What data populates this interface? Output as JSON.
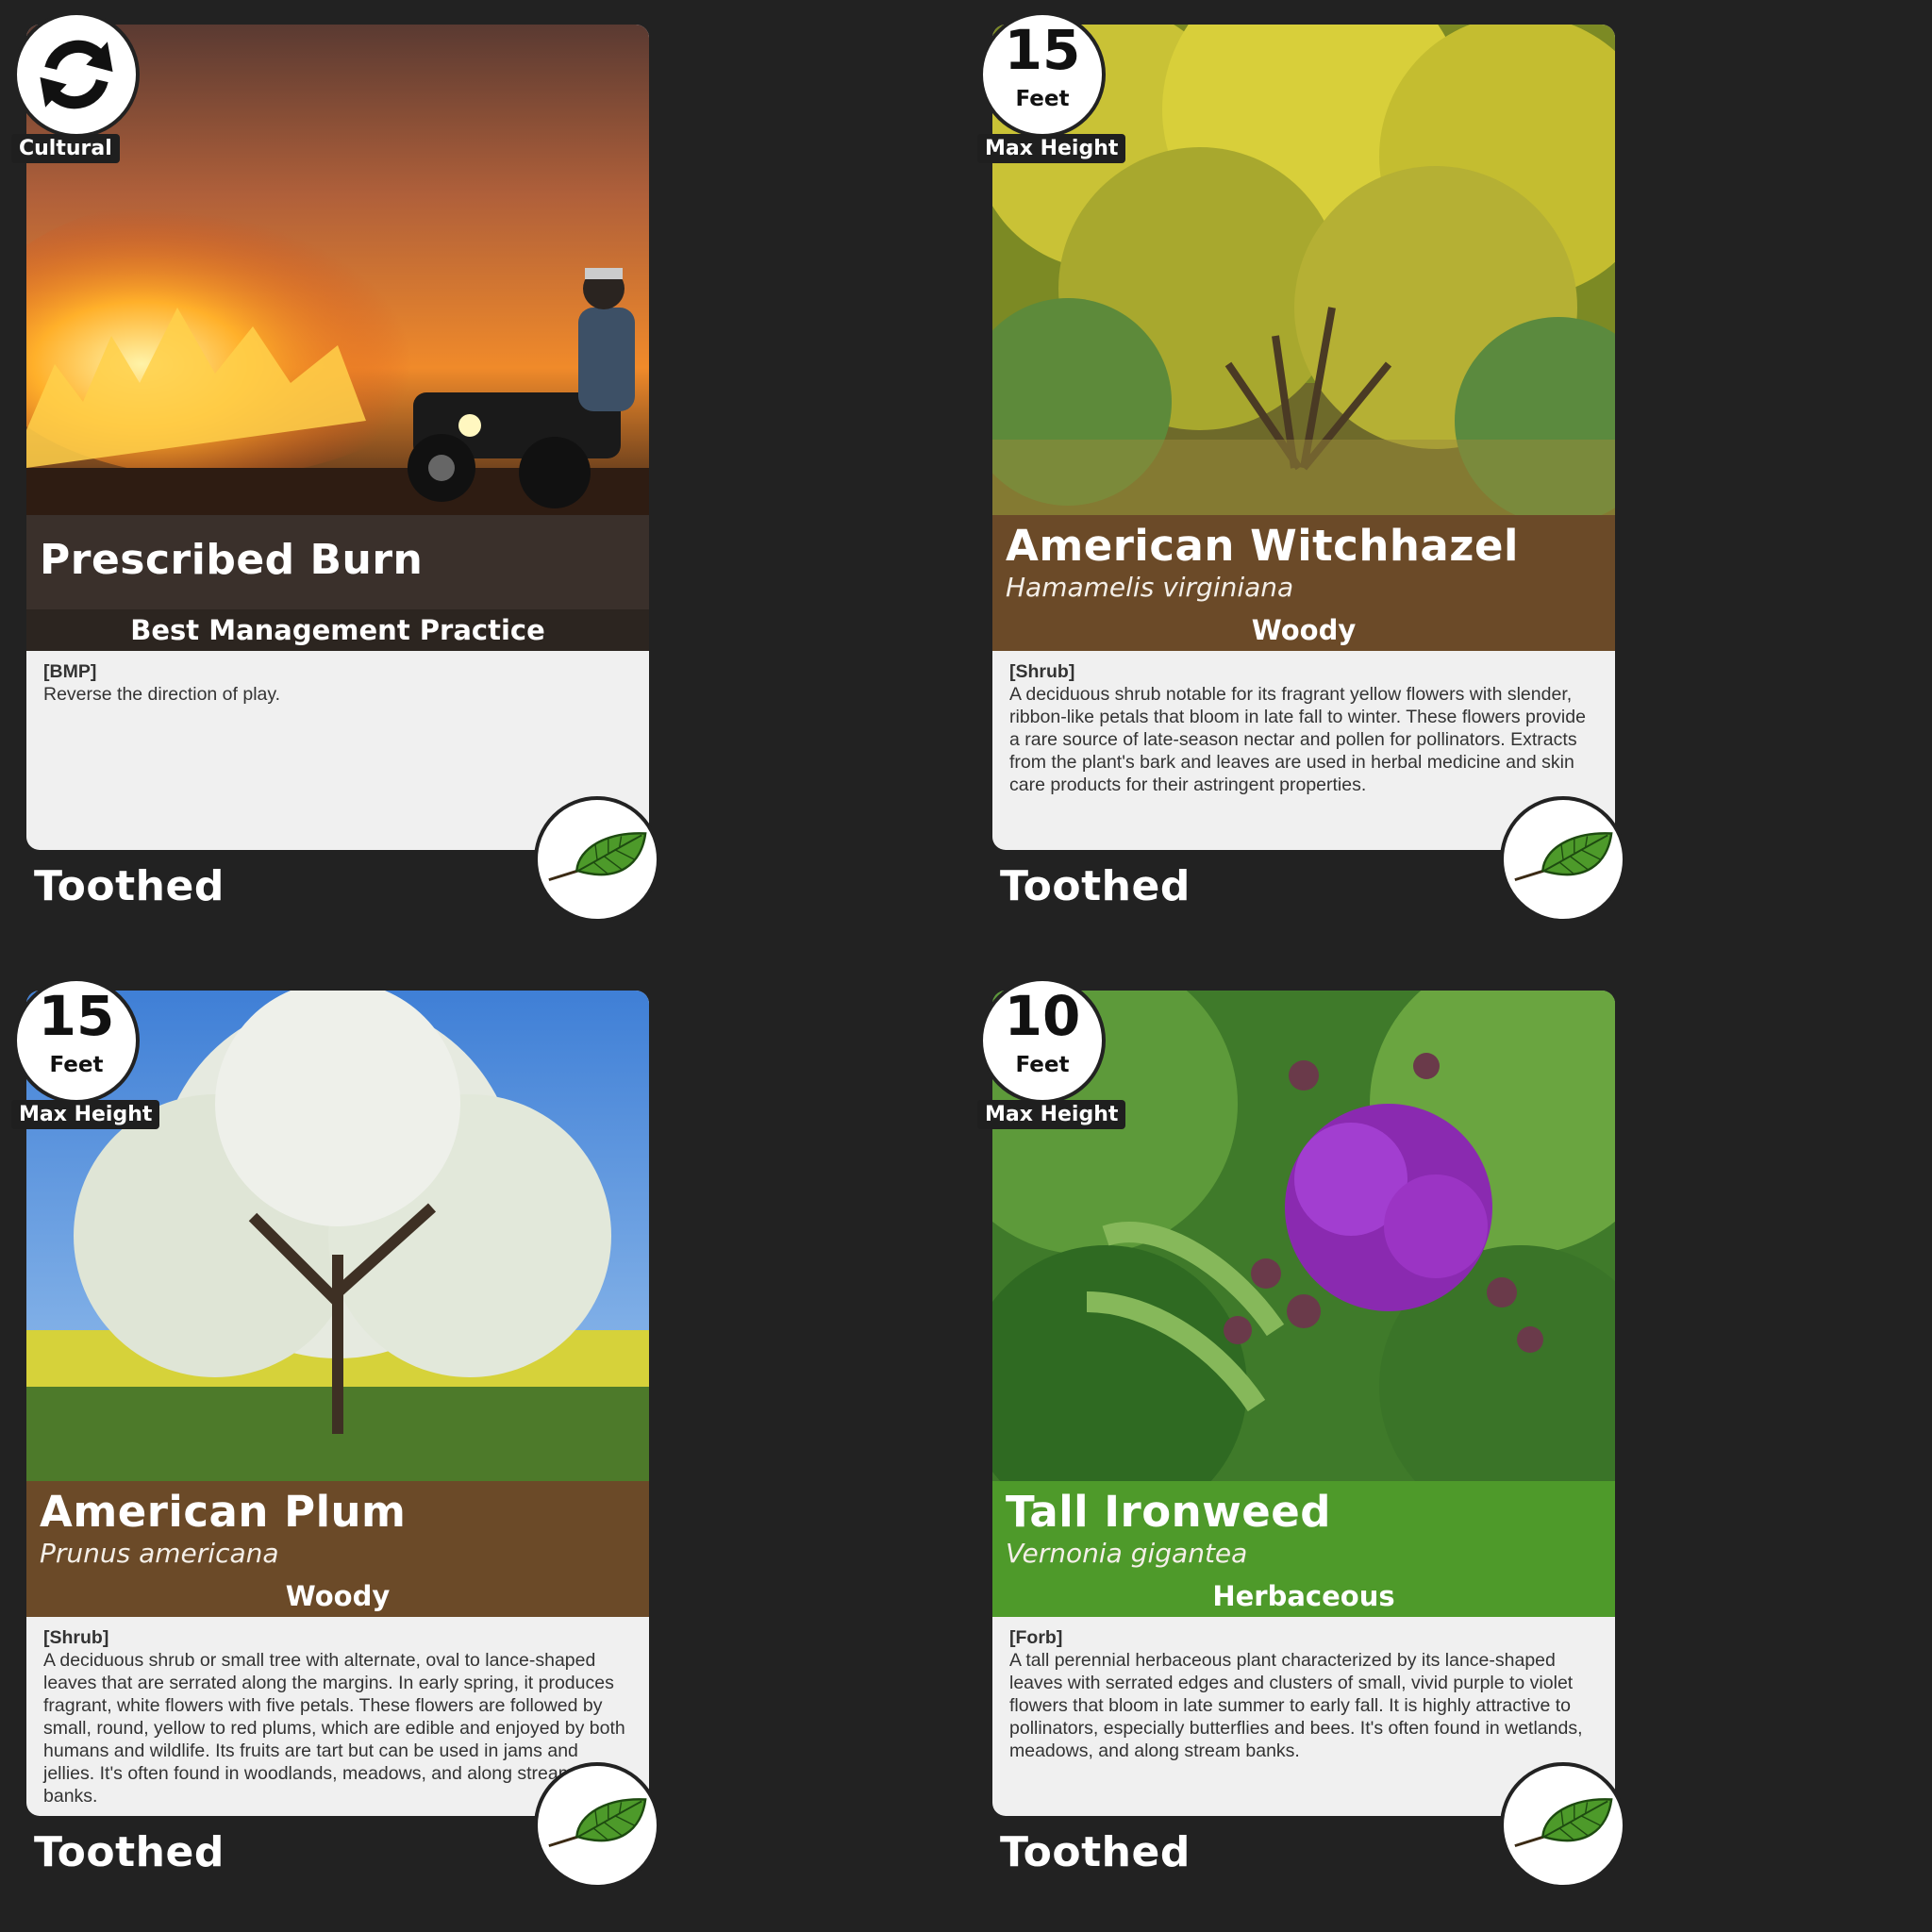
{
  "cards": [
    {
      "badge_top": "",
      "badge_unit": "",
      "badge_label": "Cultural",
      "badge_icon": "cycle-arrows-icon",
      "title": "Prescribed Burn",
      "scientific": "",
      "category": "Best Management Practice",
      "tag": "[BMP]",
      "description": "Reverse the direction of play.",
      "footer": "Toothed",
      "footer_icon": "toothed-leaf-icon"
    },
    {
      "badge_top": "15",
      "badge_unit": "Feet",
      "badge_label": "Max Height",
      "title": "American Witchhazel",
      "scientific": "Hamamelis virginiana",
      "category": "Woody",
      "tag": "[Shrub]",
      "description": "A deciduous shrub notable for its fragrant yellow flowers with slender, ribbon-like petals that bloom in late fall to winter. These flowers provide a rare source of late-season nectar and pollen for pollinators. Extracts from the plant's bark and leaves are used in herbal medicine and skin care products for their astringent properties.",
      "footer": "Toothed",
      "footer_icon": "toothed-leaf-icon"
    },
    {
      "badge_top": "15",
      "badge_unit": "Feet",
      "badge_label": "Max Height",
      "title": "American Plum",
      "scientific": "Prunus americana",
      "category": "Woody",
      "tag": "[Shrub]",
      "description": "A deciduous shrub or small tree with alternate, oval to lance-shaped leaves that are serrated along the margins. In early spring, it produces fragrant, white flowers with five petals. These flowers are followed by small, round, yellow to red plums, which are edible and enjoyed by both humans and wildlife. Its fruits are tart but can be used in jams and jellies. It's often found in woodlands, meadows, and along stream banks.",
      "footer": "Toothed",
      "footer_icon": "toothed-leaf-icon"
    },
    {
      "badge_top": "10",
      "badge_unit": "Feet",
      "badge_label": "Max Height",
      "title": "Tall Ironweed",
      "scientific": "Vernonia gigantea",
      "category": "Herbaceous",
      "tag": "[Forb]",
      "description": "A tall perennial herbaceous plant characterized by its lance-shaped leaves with serrated edges and clusters of small, vivid purple to violet flowers that bloom in late summer to early fall. It is highly attractive to pollinators, especially butterflies and bees. It's often found in wetlands, meadows, and along stream banks.",
      "footer": "Toothed",
      "footer_icon": "toothed-leaf-icon"
    }
  ],
  "colors": {
    "background": "#222222",
    "woody": "#6b4a28",
    "herbaceous": "#4e9a2a",
    "bmp": "#2c2520"
  }
}
